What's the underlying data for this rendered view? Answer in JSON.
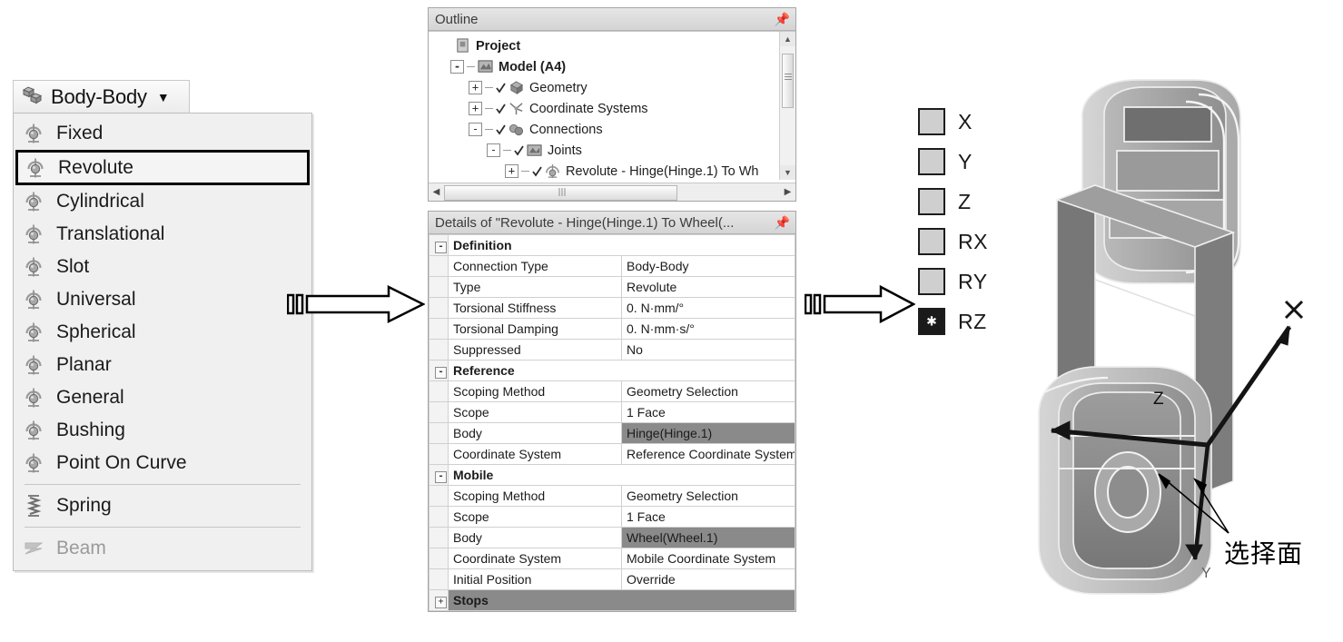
{
  "joint_menu": {
    "button_label": "Body-Body",
    "button_icon": "body-body-icon",
    "caret_icon": "chevron-down-icon",
    "items": [
      {
        "label": "Fixed",
        "icon": "joint-icon",
        "state": "normal"
      },
      {
        "label": "Revolute",
        "icon": "joint-icon",
        "state": "selected"
      },
      {
        "label": "Cylindrical",
        "icon": "joint-icon",
        "state": "normal"
      },
      {
        "label": "Translational",
        "icon": "joint-icon",
        "state": "normal"
      },
      {
        "label": "Slot",
        "icon": "joint-icon",
        "state": "normal"
      },
      {
        "label": "Universal",
        "icon": "joint-icon",
        "state": "normal"
      },
      {
        "label": "Spherical",
        "icon": "joint-icon",
        "state": "normal"
      },
      {
        "label": "Planar",
        "icon": "joint-icon",
        "state": "normal"
      },
      {
        "label": "General",
        "icon": "joint-icon",
        "state": "normal"
      },
      {
        "label": "Bushing",
        "icon": "joint-icon",
        "state": "normal"
      },
      {
        "label": "Point On Curve",
        "icon": "joint-icon",
        "state": "normal"
      },
      {
        "label": "Spring",
        "icon": "spring-icon",
        "state": "normal",
        "sep_before": true
      },
      {
        "label": "Beam",
        "icon": "beam-icon",
        "state": "disabled",
        "sep_before": true
      }
    ]
  },
  "outline": {
    "title": "Outline",
    "pin_icon": "pin-icon",
    "nodes": [
      {
        "label": "Project",
        "depth": 0,
        "toggle": "",
        "bold": true,
        "icon": "project-icon"
      },
      {
        "label": "Model (A4)",
        "depth": 1,
        "toggle": "-",
        "bold": true,
        "icon": "model-icon"
      },
      {
        "label": "Geometry",
        "depth": 2,
        "toggle": "+",
        "bold": false,
        "icon": "geometry-icon"
      },
      {
        "label": "Coordinate Systems",
        "depth": 2,
        "toggle": "+",
        "bold": false,
        "icon": "coordinate-systems-icon"
      },
      {
        "label": "Connections",
        "depth": 2,
        "toggle": "-",
        "bold": false,
        "icon": "connections-icon"
      },
      {
        "label": "Joints",
        "depth": 3,
        "toggle": "-",
        "bold": false,
        "icon": "joints-icon"
      },
      {
        "label": "Revolute - Hinge(Hinge.1) To Wh",
        "depth": 4,
        "toggle": "+",
        "bold": false,
        "icon": "joint-icon"
      }
    ],
    "scroll_up_icon": "caret-up-icon",
    "scroll_down_icon": "caret-down-icon",
    "scroll_left_icon": "caret-left-icon",
    "scroll_right_icon": "caret-right-icon"
  },
  "details": {
    "title": "Details of \"Revolute - Hinge(Hinge.1) To Wheel(...",
    "pin_icon": "pin-icon",
    "rows": [
      {
        "kind": "group",
        "toggle": "-",
        "key": "Definition",
        "value": ""
      },
      {
        "kind": "row",
        "toggle": "",
        "key": "Connection Type",
        "value": "Body-Body"
      },
      {
        "kind": "row",
        "toggle": "",
        "key": "Type",
        "value": "Revolute"
      },
      {
        "kind": "row",
        "toggle": "",
        "key": "Torsional Stiffness",
        "value": "0. N·mm/°"
      },
      {
        "kind": "row",
        "toggle": "",
        "key": "Torsional Damping",
        "value": "0. N·mm·s/°"
      },
      {
        "kind": "row",
        "toggle": "",
        "key": "Suppressed",
        "value": "No"
      },
      {
        "kind": "group",
        "toggle": "-",
        "key": "Reference",
        "value": ""
      },
      {
        "kind": "row",
        "toggle": "",
        "key": "Scoping Method",
        "value": "Geometry Selection"
      },
      {
        "kind": "row",
        "toggle": "",
        "key": "Scope",
        "value": "1 Face"
      },
      {
        "kind": "row",
        "toggle": "",
        "key": "Body",
        "value": "Hinge(Hinge.1)",
        "highlight": true
      },
      {
        "kind": "row",
        "toggle": "",
        "key": "Coordinate System",
        "value": "Reference Coordinate System"
      },
      {
        "kind": "group",
        "toggle": "-",
        "key": "Mobile",
        "value": ""
      },
      {
        "kind": "row",
        "toggle": "",
        "key": "Scoping Method",
        "value": "Geometry Selection"
      },
      {
        "kind": "row",
        "toggle": "",
        "key": "Scope",
        "value": "1 Face"
      },
      {
        "kind": "row",
        "toggle": "",
        "key": "Body",
        "value": "Wheel(Wheel.1)",
        "highlight": true
      },
      {
        "kind": "row",
        "toggle": "",
        "key": "Coordinate System",
        "value": "Mobile Coordinate System"
      },
      {
        "kind": "row",
        "toggle": "",
        "key": "Initial Position",
        "value": "Override"
      },
      {
        "kind": "stops",
        "toggle": "+",
        "key": "Stops",
        "value": ""
      }
    ]
  },
  "dof": {
    "items": [
      {
        "label": "X",
        "checked": false
      },
      {
        "label": "Y",
        "checked": false
      },
      {
        "label": "Z",
        "checked": false
      },
      {
        "label": "RX",
        "checked": false
      },
      {
        "label": "RY",
        "checked": false
      },
      {
        "label": "RZ",
        "checked": true
      }
    ]
  },
  "arrows": {
    "arrow1_name": "flow-arrow-right",
    "arrow2_name": "flow-arrow-right"
  },
  "viewport": {
    "axis_x_label": "X",
    "axis_z_label": "Z",
    "axis_y_label": "Y",
    "annotation": "选择面"
  },
  "colors": {
    "menu_bg": "#f0f0f0",
    "selected_outline": "#000000",
    "highlight_row": "#8a8a8a",
    "panel_title_bg": "#dcdcdc",
    "dof_unchecked": "#cfcfcf",
    "dof_checked": "#1a1a1a"
  }
}
